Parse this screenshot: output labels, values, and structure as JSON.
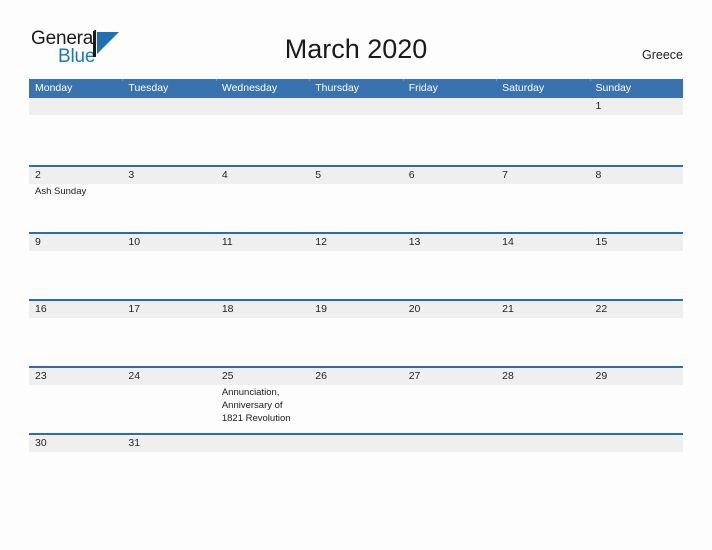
{
  "brand": {
    "name_part1": "General",
    "name_part2": "Blue",
    "mark": "triangle-logo-icon"
  },
  "header": {
    "title": "March 2020",
    "region": "Greece"
  },
  "colors": {
    "header_blue": "#3a72b0",
    "row_rule_blue": "#2b6cab",
    "date_band_gray": "#efefef",
    "brand_blue": "#1878be",
    "page_background": "#fdfdfd",
    "text_dark": "#1f1f1f"
  },
  "calendar": {
    "month": "March",
    "year": "2020",
    "weekday_headers": [
      "Monday",
      "Tuesday",
      "Wednesday",
      "Thursday",
      "Friday",
      "Saturday",
      "Sunday"
    ],
    "weeks": [
      {
        "height": 67,
        "days": [
          {
            "num": "",
            "events": []
          },
          {
            "num": "",
            "events": []
          },
          {
            "num": "",
            "events": []
          },
          {
            "num": "",
            "events": []
          },
          {
            "num": "",
            "events": []
          },
          {
            "num": "",
            "events": []
          },
          {
            "num": "1",
            "events": []
          }
        ]
      },
      {
        "height": 67,
        "days": [
          {
            "num": "2",
            "events": [
              "Ash Sunday"
            ]
          },
          {
            "num": "3",
            "events": []
          },
          {
            "num": "4",
            "events": []
          },
          {
            "num": "5",
            "events": []
          },
          {
            "num": "6",
            "events": []
          },
          {
            "num": "7",
            "events": []
          },
          {
            "num": "8",
            "events": []
          }
        ]
      },
      {
        "height": 67,
        "days": [
          {
            "num": "9",
            "events": []
          },
          {
            "num": "10",
            "events": []
          },
          {
            "num": "11",
            "events": []
          },
          {
            "num": "12",
            "events": []
          },
          {
            "num": "13",
            "events": []
          },
          {
            "num": "14",
            "events": []
          },
          {
            "num": "15",
            "events": []
          }
        ]
      },
      {
        "height": 67,
        "days": [
          {
            "num": "16",
            "events": []
          },
          {
            "num": "17",
            "events": []
          },
          {
            "num": "18",
            "events": []
          },
          {
            "num": "19",
            "events": []
          },
          {
            "num": "20",
            "events": []
          },
          {
            "num": "21",
            "events": []
          },
          {
            "num": "22",
            "events": []
          }
        ]
      },
      {
        "height": 67,
        "days": [
          {
            "num": "23",
            "events": []
          },
          {
            "num": "24",
            "events": []
          },
          {
            "num": "25",
            "events": [
              "Annunciation, Anniversary of 1821 Revolution"
            ]
          },
          {
            "num": "26",
            "events": []
          },
          {
            "num": "27",
            "events": []
          },
          {
            "num": "28",
            "events": []
          },
          {
            "num": "29",
            "events": []
          }
        ]
      },
      {
        "height": 31,
        "days": [
          {
            "num": "30",
            "events": []
          },
          {
            "num": "31",
            "events": []
          },
          {
            "num": "",
            "events": []
          },
          {
            "num": "",
            "events": []
          },
          {
            "num": "",
            "events": []
          },
          {
            "num": "",
            "events": []
          },
          {
            "num": "",
            "events": []
          }
        ]
      }
    ]
  }
}
